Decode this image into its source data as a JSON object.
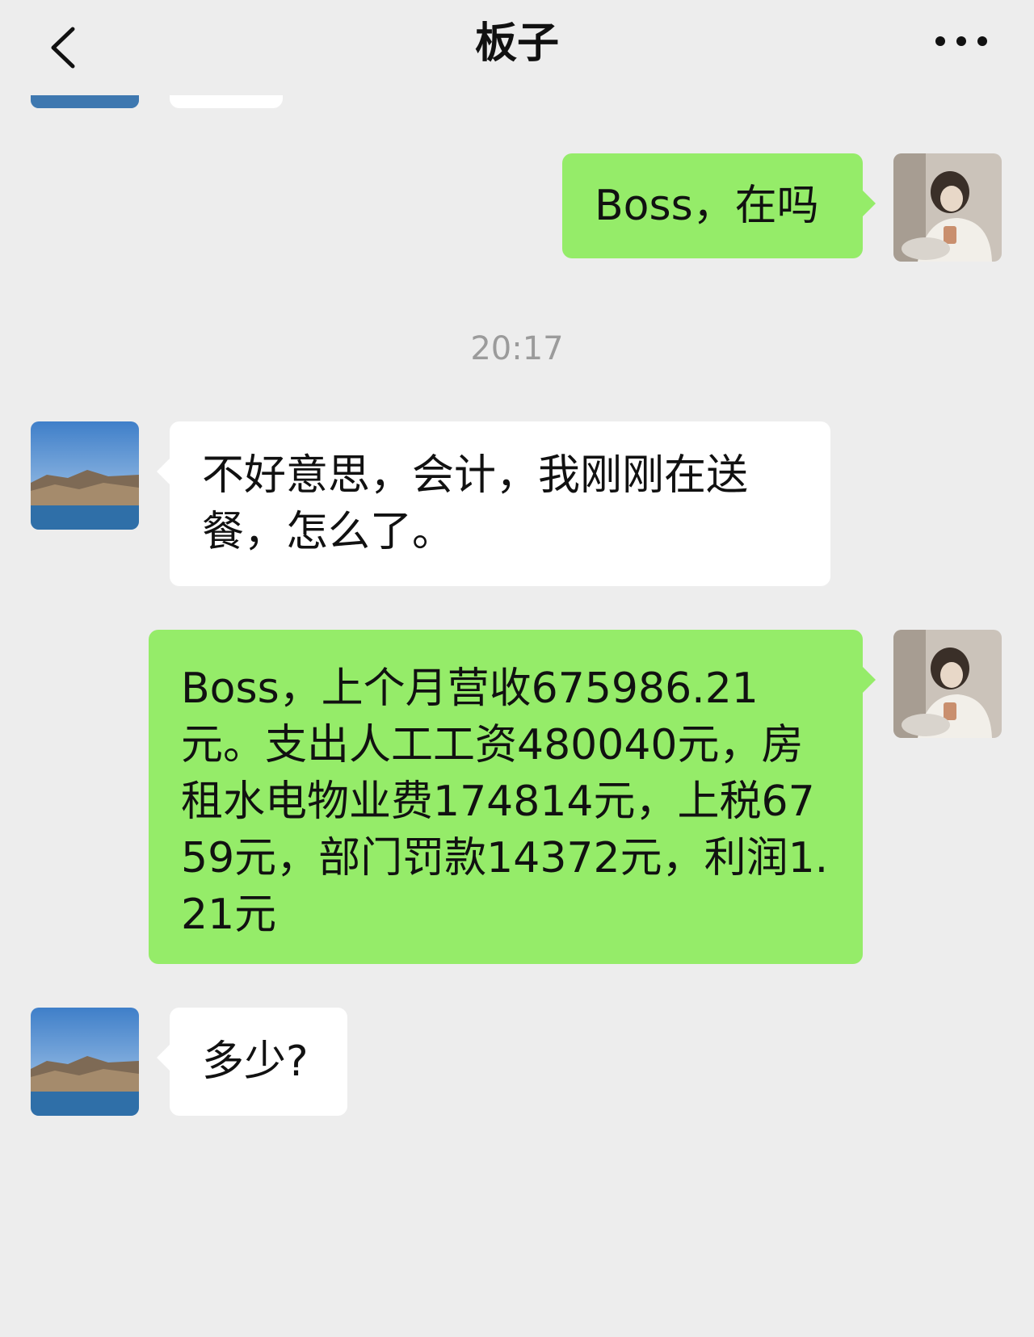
{
  "header": {
    "title": "板子",
    "back_icon": "chevron-left-icon",
    "more_icon": "more-dots-icon"
  },
  "messages": [
    {
      "side": "right",
      "text": "Boss，在吗"
    },
    {
      "timestamp": "20:17"
    },
    {
      "side": "left",
      "text": "不好意思，会计，我刚刚在送餐，怎么了。"
    },
    {
      "side": "right",
      "text": "Boss，上个月营收675986.21元。支出人工工资480040元，房租水电物业费174814元，上税6759元，部门罚款14372元，利润1.21元"
    },
    {
      "side": "left",
      "text": "多少?"
    }
  ],
  "colors": {
    "background": "#ededed",
    "incoming_bubble": "#ffffff",
    "outgoing_bubble": "#95ec69",
    "timestamp": "#9b9b9b"
  }
}
